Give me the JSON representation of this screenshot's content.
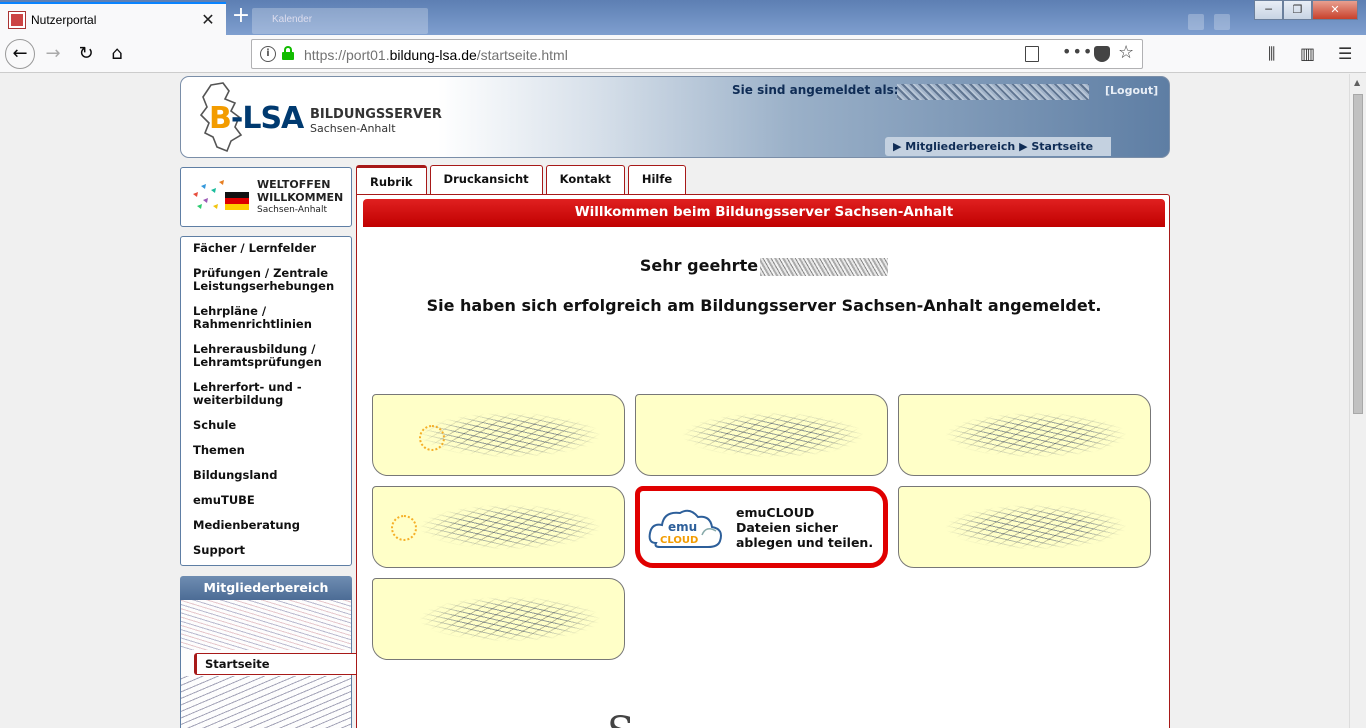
{
  "browser": {
    "tab_title": "Nutzerportal",
    "tab_close": "✕",
    "new_tab": "+",
    "background_tab_title": "Kalender",
    "url_prefix": "https://port01.",
    "url_domain": "bildung-lsa.de",
    "url_path": "/startseite.html",
    "more_icon": "•••",
    "window_controls": {
      "minimize": "─",
      "maximize": "❐",
      "close": "✕"
    }
  },
  "header": {
    "logo_b": "B",
    "logo_rest": "-LSA",
    "title_line1": "BILDUNGSSERVER",
    "title_line2": "Sachsen-Anhalt",
    "login_label": "Sie sind angemeldet als:",
    "logout": "[Logout]",
    "breadcrumb": "▶ Mitgliederbereich ▶ Startseite"
  },
  "sidebar": {
    "welt_title1": "WELTOFFEN",
    "welt_title2": "WILLKOMMEN",
    "welt_sub": "Sachsen-Anhalt",
    "items": [
      {
        "label": "Fächer / Lernfelder"
      },
      {
        "label": "Prüfungen / Zentrale Leistungserhebungen"
      },
      {
        "label": "Lehrpläne / Rahmenrichtlinien"
      },
      {
        "label": "Lehrerausbildung / Lehramtsprüfungen"
      },
      {
        "label": "Lehrerfort- und -weiterbildung"
      },
      {
        "label": "Schule"
      },
      {
        "label": "Themen"
      },
      {
        "label": "Bildungsland"
      },
      {
        "label": "emuTUBE"
      },
      {
        "label": "Medienberatung"
      },
      {
        "label": "Support"
      }
    ],
    "members_heading": "Mitgliederbereich",
    "members_active": "Startseite"
  },
  "content": {
    "tabs": [
      {
        "label": "Rubrik"
      },
      {
        "label": "Druckansicht"
      },
      {
        "label": "Kontakt"
      },
      {
        "label": "Hilfe"
      }
    ],
    "welcome_bar": "Willkommen beim Bildungsserver Sachsen-Anhalt",
    "greeting": "Sehr geehrte",
    "success": "Sie haben sich erfolgreich am Bildungsserver Sachsen-Anhalt angemeldet.",
    "cloud_tile": {
      "logo_top": "emu",
      "logo_bottom": "CLOUD",
      "title": "emuCLOUD",
      "line1": "Dateien sicher",
      "line2": "ablegen und teilen."
    },
    "bottom_glyph": "S"
  },
  "colors": {
    "brand_red": "#c00000",
    "brand_blue": "#003a70",
    "brand_orange": "#f39c00",
    "tile_bg": "#ffffc8"
  }
}
